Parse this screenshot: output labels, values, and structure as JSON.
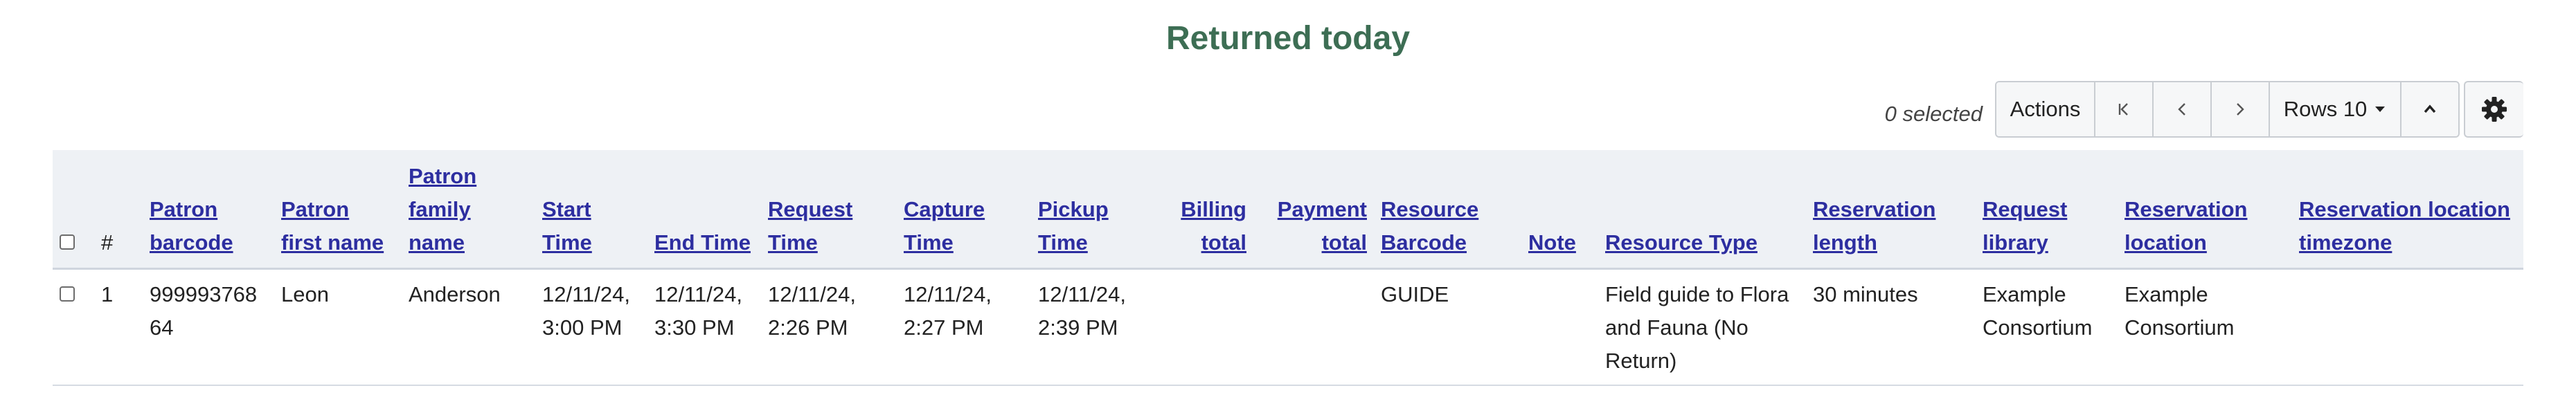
{
  "title": "Returned today",
  "toolbar": {
    "selected_count": "0 selected",
    "actions_label": "Actions",
    "rows_label": "Rows 10",
    "icons": {
      "first": "first-page-icon",
      "prev": "chevron-left-icon",
      "next": "chevron-right-icon",
      "rows_caret": "caret-down-icon",
      "collapse": "chevron-up-icon",
      "settings": "gear-icon"
    }
  },
  "table": {
    "headers": {
      "num": "#",
      "patron_barcode": "Patron barcode",
      "patron_first_name": "Patron first name",
      "patron_family_name": "Patron family name",
      "start_time": "Start Time",
      "end_time": "End Time",
      "request_time": "Request Time",
      "capture_time": "Capture Time",
      "pickup_time": "Pickup Time",
      "billing_total": "Billing total",
      "payment_total": "Payment total",
      "resource_barcode": "Resource Barcode",
      "note": "Note",
      "resource_type": "Resource Type",
      "reservation_length": "Reservation length",
      "request_library": "Request library",
      "reservation_location": "Reservation location",
      "reservation_location_timezone": "Reservation location timezone"
    },
    "rows": [
      {
        "num": "1",
        "patron_barcode": "99999376864",
        "patron_first_name": "Leon",
        "patron_family_name": "Anderson",
        "start_time": "12/11/24, 3:00 PM",
        "end_time": "12/11/24, 3:30 PM",
        "request_time": "12/11/24, 2:26 PM",
        "capture_time": "12/11/24, 2:27 PM",
        "pickup_time": "12/11/24, 2:39 PM",
        "billing_total": "",
        "payment_total": "",
        "resource_barcode": "GUIDE",
        "note": "",
        "resource_type": "Field guide to Flora and Fauna (No Return)",
        "reservation_length": "30 minutes",
        "request_library": "Example Consortium",
        "reservation_location": "Example Consortium",
        "reservation_location_timezone": ""
      }
    ]
  }
}
